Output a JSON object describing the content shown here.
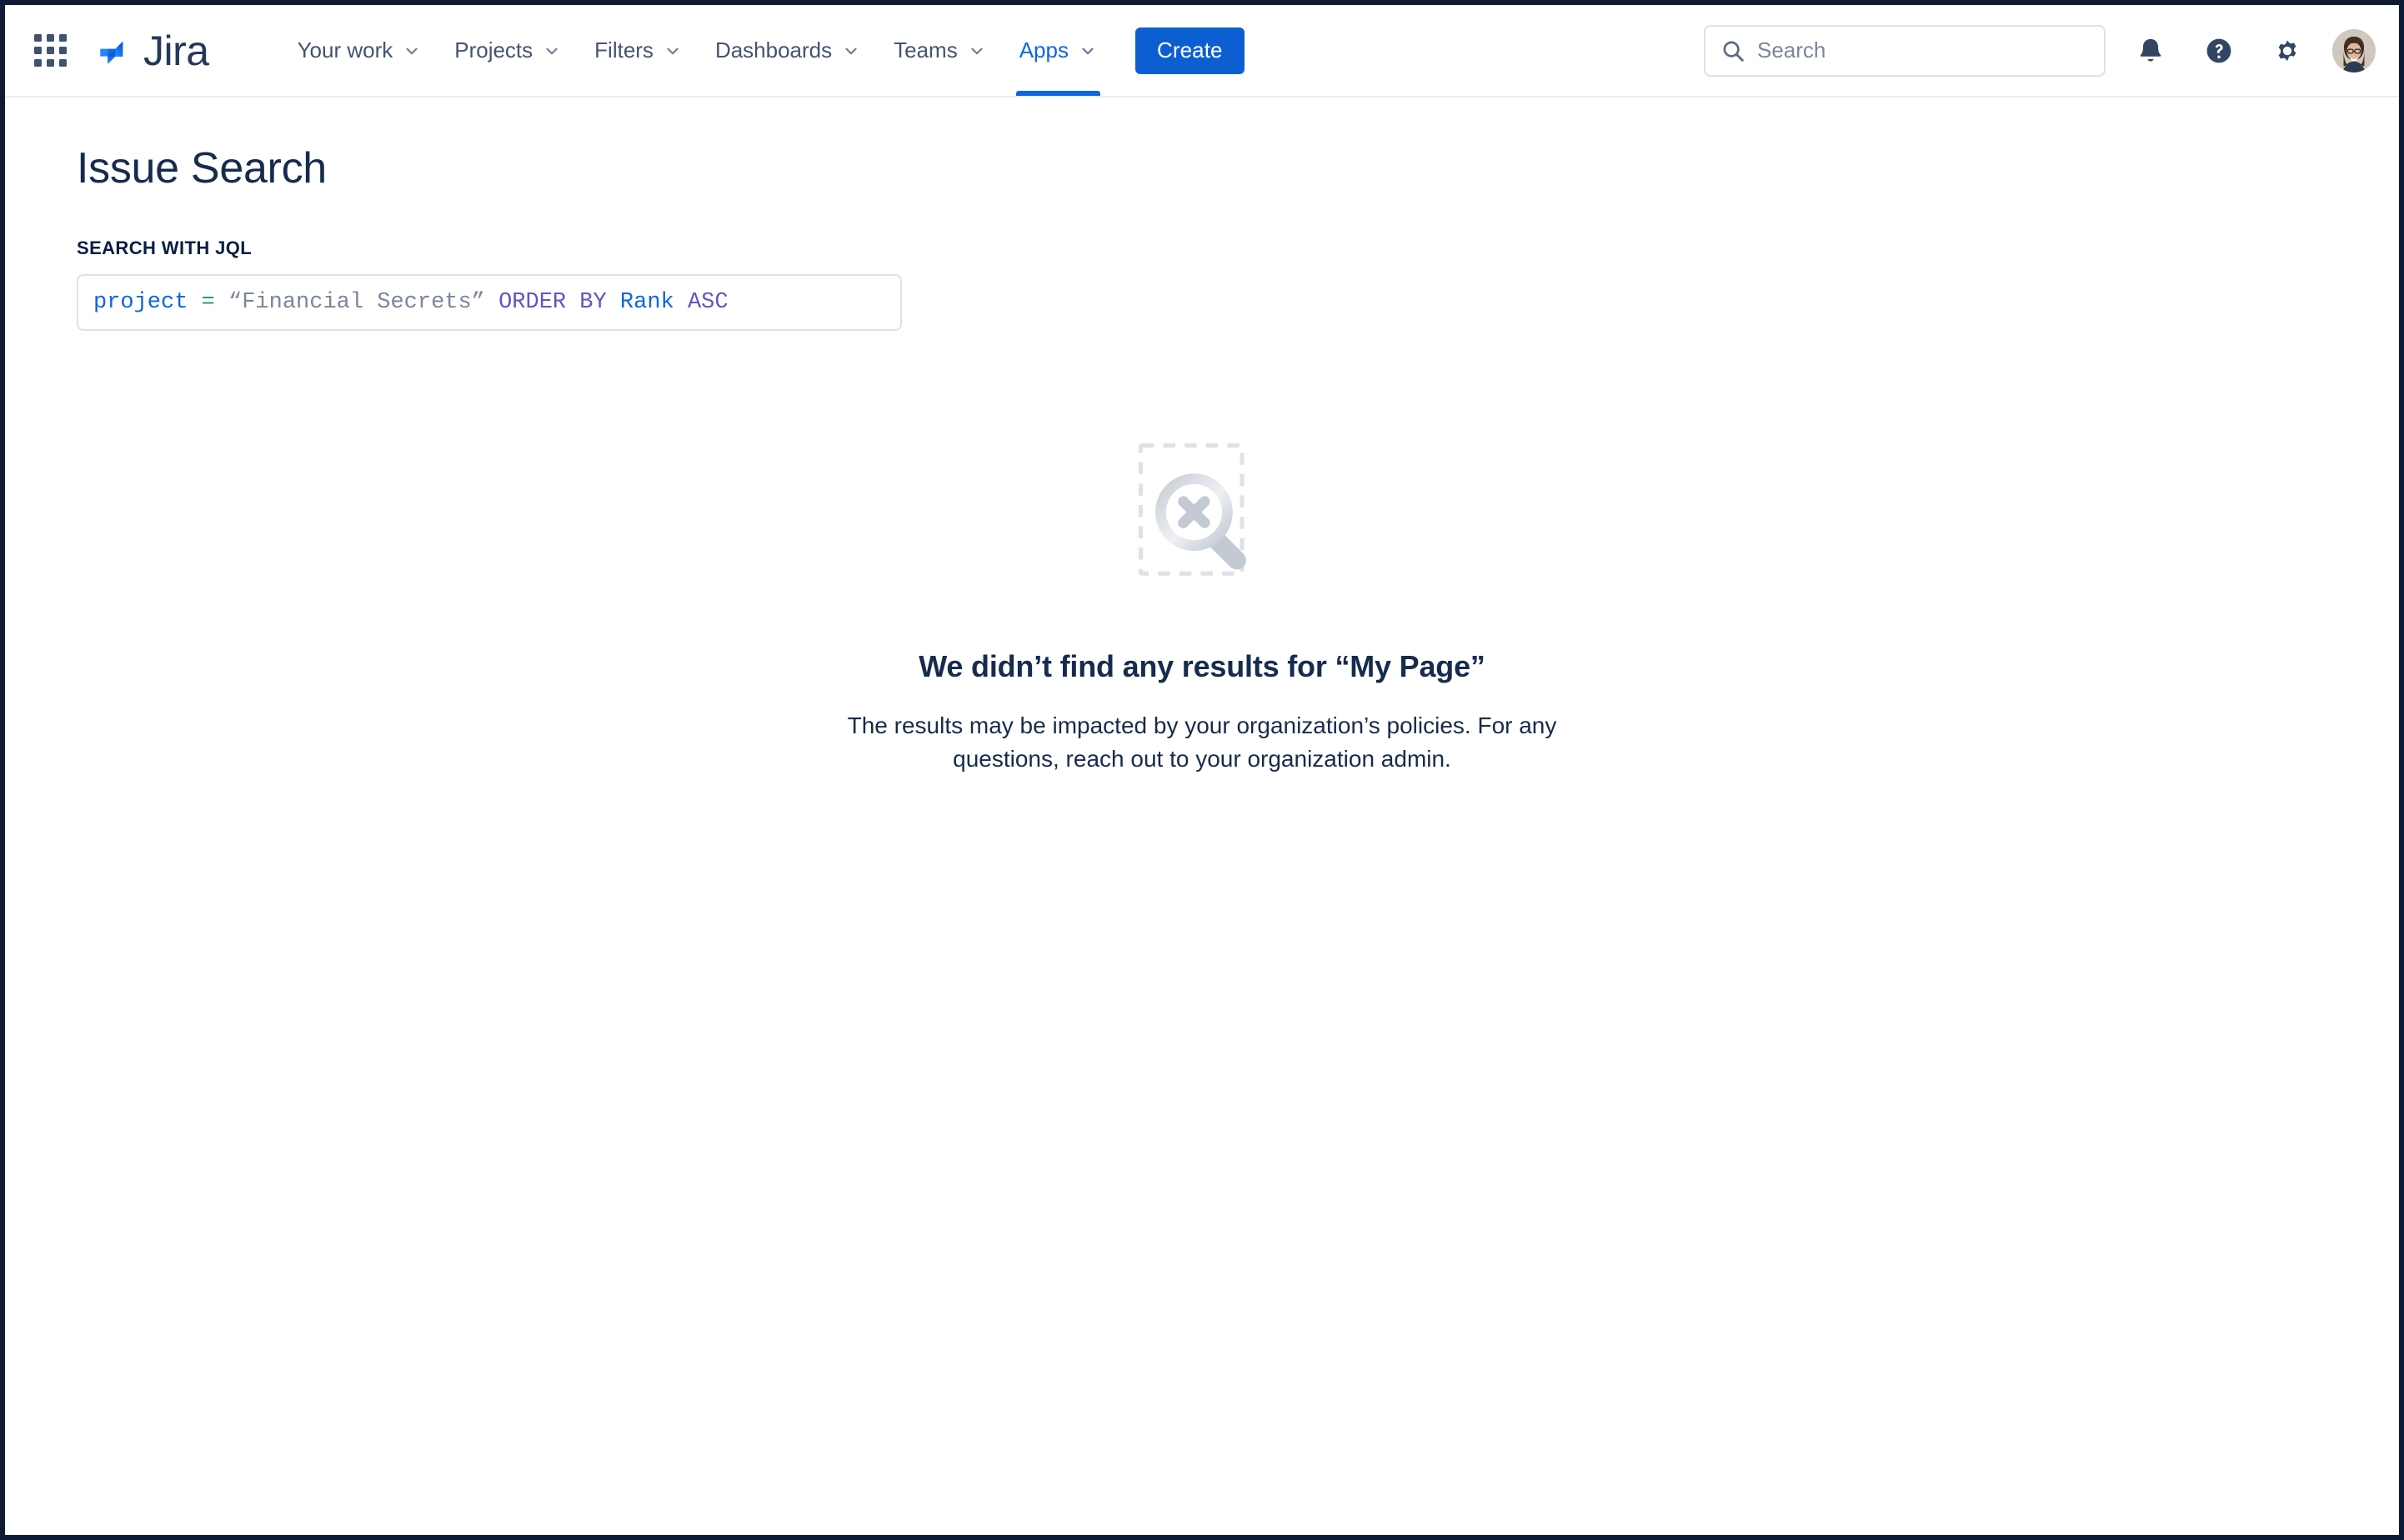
{
  "colors": {
    "brand_blue": "#0c66e4",
    "create_button_blue": "#0c5fd1",
    "text_navy": "#172b4d",
    "nav_text": "#44546f",
    "muted": "#7a869a",
    "border": "#dfe1e6",
    "frame": "#0d1b34",
    "jql_field_token": "#0c66e4",
    "jql_operator_token": "#22a06b",
    "jql_string_token": "#7a869a",
    "jql_keyword_token": "#6554c0"
  },
  "topnav": {
    "app_switcher_label": "App switcher",
    "brand": {
      "name": "Jira",
      "icon": "jira-logo-icon"
    },
    "items": [
      {
        "label": "Your work",
        "active": false,
        "has_dropdown": true
      },
      {
        "label": "Projects",
        "active": false,
        "has_dropdown": true
      },
      {
        "label": "Filters",
        "active": false,
        "has_dropdown": true
      },
      {
        "label": "Dashboards",
        "active": false,
        "has_dropdown": true
      },
      {
        "label": "Teams",
        "active": false,
        "has_dropdown": true
      },
      {
        "label": "Apps",
        "active": true,
        "has_dropdown": true
      }
    ],
    "create_label": "Create",
    "search": {
      "placeholder": "Search",
      "value": "",
      "icon": "search-icon"
    },
    "icons": [
      {
        "name": "notifications-bell-icon",
        "label": "Notifications"
      },
      {
        "name": "help-question-icon",
        "label": "Help"
      },
      {
        "name": "settings-gear-icon",
        "label": "Settings"
      }
    ],
    "avatar_label": "Your profile and settings"
  },
  "page": {
    "title": "Issue Search",
    "jql": {
      "label": "SEARCH WITH JQL",
      "query": "project = “Financial Secrets” ORDER BY Rank ASC",
      "tokens": [
        {
          "text": "project",
          "type": "field"
        },
        {
          "text": " ",
          "type": "plain"
        },
        {
          "text": "=",
          "type": "op"
        },
        {
          "text": " ",
          "type": "plain"
        },
        {
          "text": "“Financial Secrets”",
          "type": "string"
        },
        {
          "text": " ",
          "type": "plain"
        },
        {
          "text": "ORDER BY",
          "type": "keyword"
        },
        {
          "text": " ",
          "type": "plain"
        },
        {
          "text": "Rank",
          "type": "order"
        },
        {
          "text": " ",
          "type": "plain"
        },
        {
          "text": "ASC",
          "type": "keyword"
        }
      ]
    },
    "empty_state": {
      "illustration": "no-results-magnifier-icon",
      "title": "We didn’t find any results for “My Page”",
      "description": "The results may be impacted by your organization’s policies. For any questions, reach out to your organization admin."
    }
  }
}
